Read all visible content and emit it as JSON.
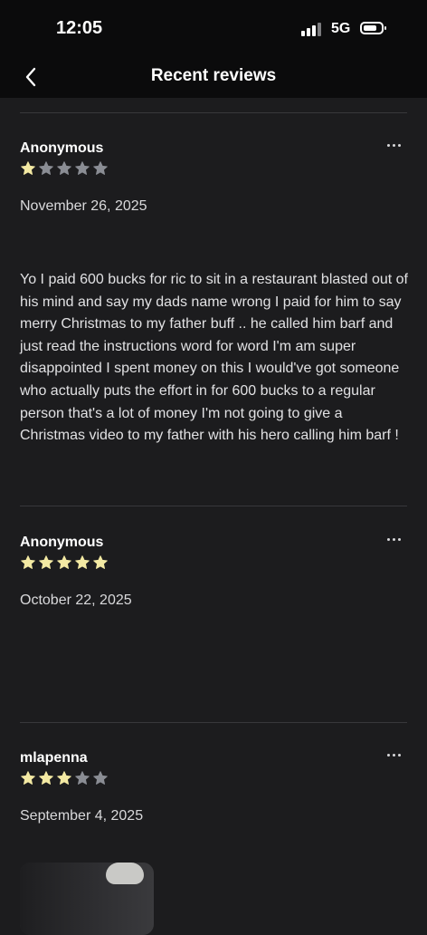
{
  "status_bar": {
    "time": "12:05",
    "network": "5G"
  },
  "nav": {
    "title": "Recent reviews",
    "back_icon": "chevron-left-icon"
  },
  "colors": {
    "star_filled": "#f3e9a3",
    "star_empty": "#8a8d94",
    "background": "#1c1c1e",
    "bar": "#0b0b0c"
  },
  "reviews": [
    {
      "author": "Anonymous",
      "rating": 1,
      "max_rating": 5,
      "date": "November 26, 2025",
      "text": "Yo I paid 600 bucks for ric to sit in a restaurant blasted out of his mind and say my dads name wrong I paid for him to say merry Christmas to my father buff .. he called him barf and just read the instructions word for word I'm am super disappointed I spent money on this I would've got someone who actually puts the effort in for 600 bucks to a regular person that's a lot of money I'm not going to give a Christmas video to my father with his hero calling him barf !"
    },
    {
      "author": "Anonymous",
      "rating": 5,
      "max_rating": 5,
      "date": "October 22, 2025",
      "text": ""
    },
    {
      "author": "mlapenna",
      "rating": 3,
      "max_rating": 5,
      "date": "September 4, 2025",
      "text": ""
    }
  ]
}
